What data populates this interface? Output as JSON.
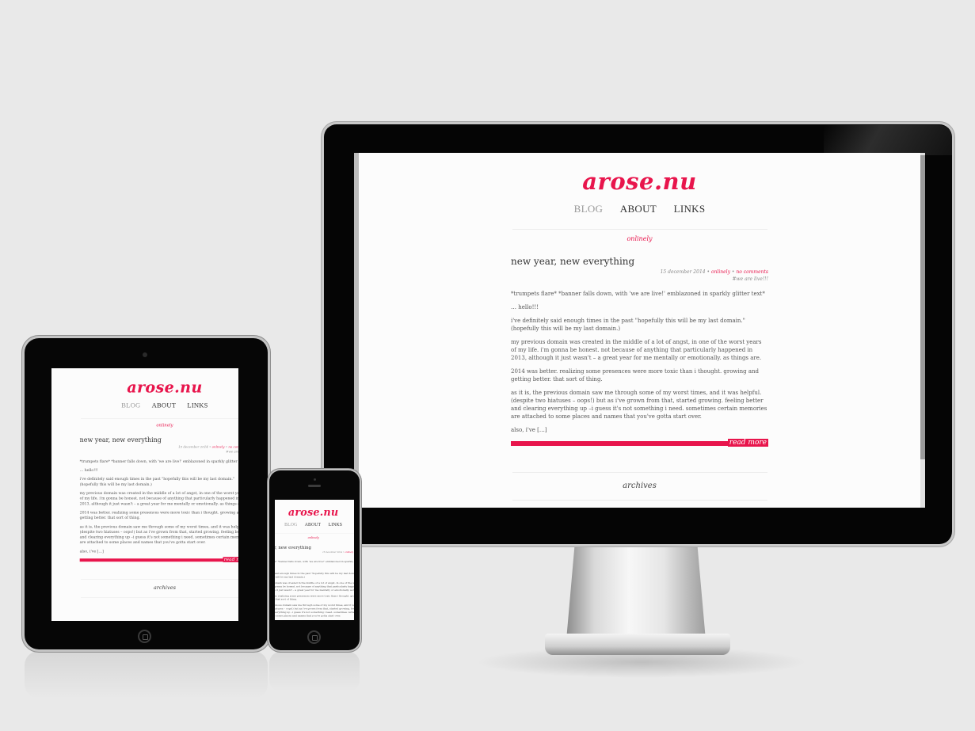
{
  "site": {
    "title": "arose.nu",
    "nav": [
      "BLOG",
      "ABOUT",
      "LINKS"
    ],
    "category": "onlinely",
    "post": {
      "title": "new year, new everything",
      "date": "15 december 2014",
      "bullet1": " • ",
      "category": "onlinely",
      "bullet2": " • ",
      "comments": "no comments",
      "tag": "#we are live!!!",
      "paragraphs": [
        "*trumpets flare* *banner falls down, with 'we are live!' emblazoned in sparkly glitter text*",
        "… hello!!!",
        "i've definitely said enough times in the past \"hopefully this will be my last domain.\" (hopefully this will be my last domain.)",
        "my previous domain was created in the middle of a lot of angst, in one of the worst years of my life. i'm gonna be honest. not because of anything that particularly happened in 2013, although it just wasn't – a great year for me mentally or emotionally. as things are.",
        "2014 was better. realizing some presences were more toxic than i thought. growing and getting better. that sort of thing.",
        "as it is, the previous domain saw me through some of my worst times, and it was helpful. (despite two hiatuses – oops!) but as i've grown from that, started growing. feeling better and clearing everything up –i guess it's not something i need. sometimes certain memories are attached to some places and names that you've gotta start over.",
        "also, i've […]"
      ],
      "read_more": "read more"
    },
    "archives": "archives"
  },
  "devices": [
    "monitor",
    "tablet",
    "phone"
  ],
  "colors": {
    "accent": "#e8154c",
    "background": "#e9e9e9",
    "screen": "#fcfcfc",
    "bezel": "#050505"
  }
}
